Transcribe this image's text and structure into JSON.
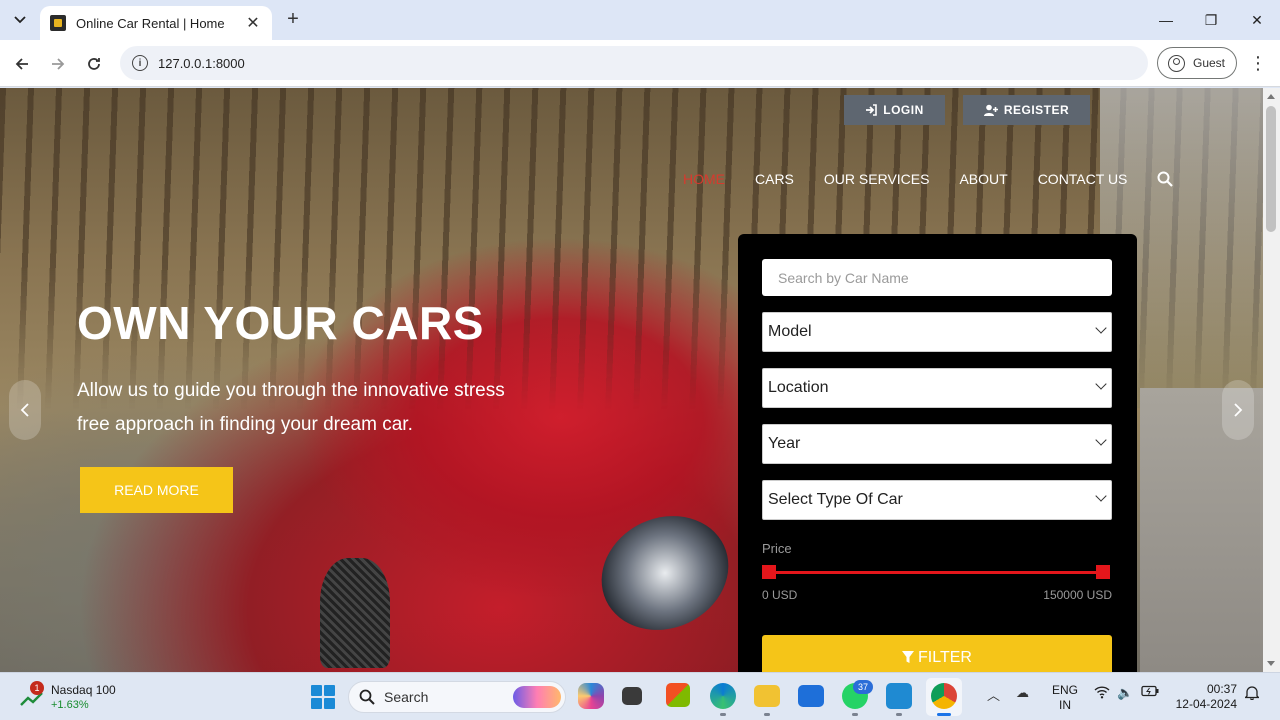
{
  "browser": {
    "tab_title": "Online Car Rental | Home",
    "new_tab_glyph": "+",
    "close_glyph": "✕",
    "url": "127.0.0.1:8000",
    "profile_label": "Guest",
    "window_controls": {
      "minimize": "—",
      "restore": "❐",
      "close": "✕"
    }
  },
  "site": {
    "auth": {
      "login_label": "LOGIN",
      "register_label": "REGISTER"
    },
    "nav": [
      "HOME",
      "CARS",
      "OUR SERVICES",
      "ABOUT",
      "CONTACT US"
    ],
    "active_nav": "HOME",
    "hero": {
      "title": "OWN YOUR CARS",
      "subtitle": "Allow us to guide you through the innovative stress free approach in finding your dream car.",
      "cta_label": "READ MORE"
    },
    "filter": {
      "search_placeholder": "Search by Car Name",
      "selects": [
        "Model",
        "Location",
        "Year",
        "Select Type Of Car"
      ],
      "price_label": "Price",
      "price_min": "0 USD",
      "price_max": "150000 USD",
      "price_range": [
        0,
        150000
      ],
      "button_label": "FILTER"
    },
    "colors": {
      "accent": "#f5c518",
      "active_nav": "#d63a2e",
      "slider": "#e4161b",
      "panel": "#000000"
    }
  },
  "taskbar": {
    "stock": {
      "badge": "1",
      "name": "Nasdaq 100",
      "change": "+1.63%"
    },
    "search_label": "Search",
    "whatsapp_badge": "37",
    "lang": {
      "line1": "ENG",
      "line2": "IN"
    },
    "time": "00:37",
    "date": "12-04-2024"
  }
}
